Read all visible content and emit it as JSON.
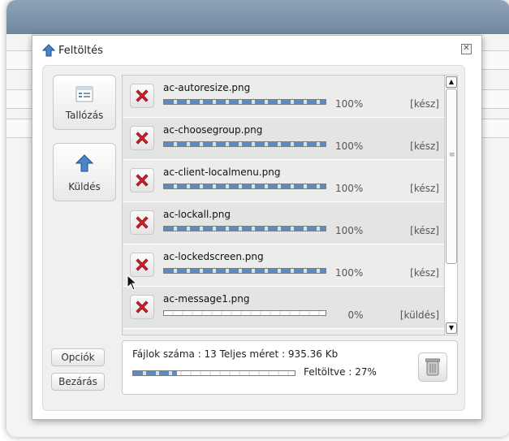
{
  "dialog": {
    "title": "Feltöltés",
    "close_symbol": "✕"
  },
  "side_buttons": {
    "browse_label": "Tallózás",
    "send_label": "Küldés",
    "options_label": "Opciók",
    "close_label": "Bezárás"
  },
  "files": [
    {
      "name": "ac-autoresize.png",
      "percent": "100%",
      "progress": 1.0,
      "status": "[kész]"
    },
    {
      "name": "ac-choosegroup.png",
      "percent": "100%",
      "progress": 1.0,
      "status": "[kész]"
    },
    {
      "name": "ac-client-localmenu.png",
      "percent": "100%",
      "progress": 1.0,
      "status": "[kész]"
    },
    {
      "name": "ac-lockall.png",
      "percent": "100%",
      "progress": 1.0,
      "status": "[kész]"
    },
    {
      "name": "ac-lockedscreen.png",
      "percent": "100%",
      "progress": 1.0,
      "status": "[kész]"
    },
    {
      "name": "ac-message1.png",
      "percent": "0%",
      "progress": 0.0,
      "status": "[küldés]"
    }
  ],
  "summary": {
    "text": "Fájlok száma : 13 Teljes méret : 935.36 Kb",
    "uploaded": "Feltöltve : 27%",
    "progress": 0.27
  },
  "scrollbar": {
    "grip_symbol": "≡"
  },
  "icons": {
    "title": "upload-arrow-icon",
    "browse": "file-browser-icon",
    "send": "upload-arrow-icon",
    "remove": "red-x-icon",
    "trash": "trash-can-icon"
  },
  "colors": {
    "progress_fill": "#5a8cc0",
    "remove_icon": "#d0202a",
    "upload_arrow": "#4a85c8"
  }
}
